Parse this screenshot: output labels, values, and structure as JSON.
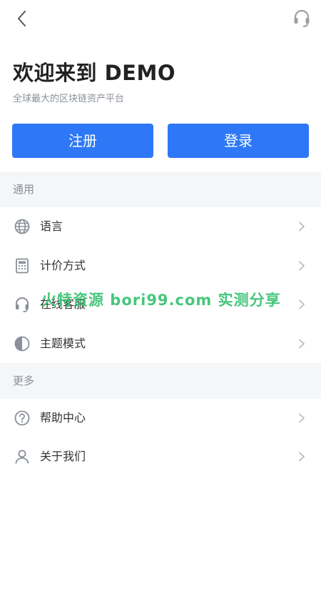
{
  "header": {
    "back_icon": "chevron-left-icon",
    "support_icon": "headset-icon"
  },
  "welcome": {
    "title": "欢迎来到 DEMO",
    "subtitle": "全球最大的区块链资产平台"
  },
  "auth": {
    "register_label": "注册",
    "login_label": "登录",
    "button_color": "#2e78f7"
  },
  "sections": {
    "general": {
      "title": "通用",
      "items": [
        {
          "label": "语言",
          "icon": "globe-icon"
        },
        {
          "label": "计价方式",
          "icon": "calculator-icon"
        },
        {
          "label": "在线客服",
          "icon": "headset-icon"
        },
        {
          "label": "主题模式",
          "icon": "half-circle-icon"
        }
      ]
    },
    "more": {
      "title": "更多",
      "items": [
        {
          "label": "帮助中心",
          "icon": "question-circle-icon"
        },
        {
          "label": "关于我们",
          "icon": "user-icon"
        }
      ]
    }
  },
  "watermark": "火特资源 bori99.com 实测分享"
}
